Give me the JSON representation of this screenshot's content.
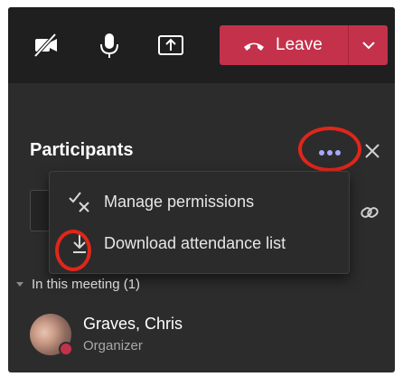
{
  "toolbar": {
    "camera_icon": "camera-off-icon",
    "mic_icon": "microphone-icon",
    "share_icon": "share-screen-icon",
    "leave_label": "Leave",
    "leave_color": "#c4314b"
  },
  "panel": {
    "title": "Participants",
    "more_icon": "more-options-icon",
    "close_icon": "close-icon",
    "link_icon": "link-icon"
  },
  "menu": {
    "items": [
      {
        "label": "Manage permissions",
        "icon": "manage-permissions-icon"
      },
      {
        "label": "Download attendance list",
        "icon": "download-icon"
      }
    ]
  },
  "section": {
    "label": "In this meeting (1)"
  },
  "participants": [
    {
      "name": "Graves, Chris",
      "role": "Organizer",
      "status_color": "#c4314b"
    }
  ],
  "annotations": {
    "highlight_color": "#e0261a"
  },
  "colors": {
    "toolbar_bg": "#1f1f1f",
    "panel_bg": "#2d2c2c",
    "accent_more": "#a6a7ff"
  }
}
